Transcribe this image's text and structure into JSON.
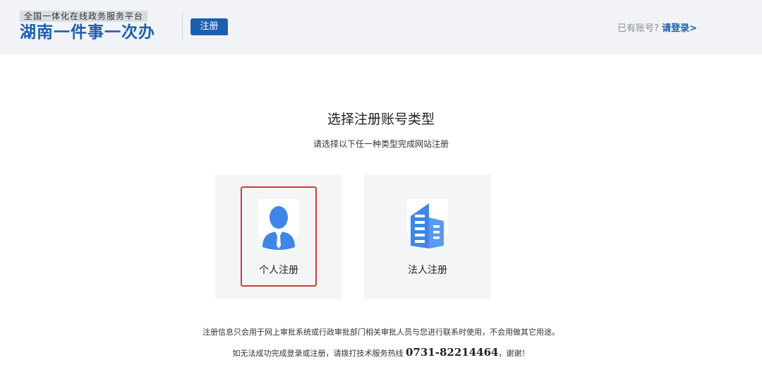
{
  "header": {
    "logo_subtitle": "全国一体化在线政务服务平台",
    "logo_title": "湖南一件事一次办",
    "page_badge": "注册",
    "login_prompt": "已有账号?",
    "login_link": "请登录>"
  },
  "main": {
    "title": "选择注册账号类型",
    "subtitle": "请选择以下任一种类型完成网站注册",
    "cards": [
      {
        "label": "个人注册",
        "icon": "person-icon",
        "selected": true
      },
      {
        "label": "法人注册",
        "icon": "building-icon",
        "selected": false
      }
    ],
    "notice": "注册信息只会用于网上审批系统或行政审批部门相关审批人员与您进行联系时使用，不会用做其它用途。",
    "help_prefix": "如无法成功完成登录或注册，请拨打技术服务热线",
    "help_hotline": "0731-82214464",
    "help_suffix": "，谢谢！"
  },
  "colors": {
    "brand_blue": "#1c5fb0",
    "icon_blue": "#3f86e6",
    "selection_red": "#d33a3a",
    "header_bg": "#f1f3f6",
    "card_bg": "#f4f5f7"
  }
}
